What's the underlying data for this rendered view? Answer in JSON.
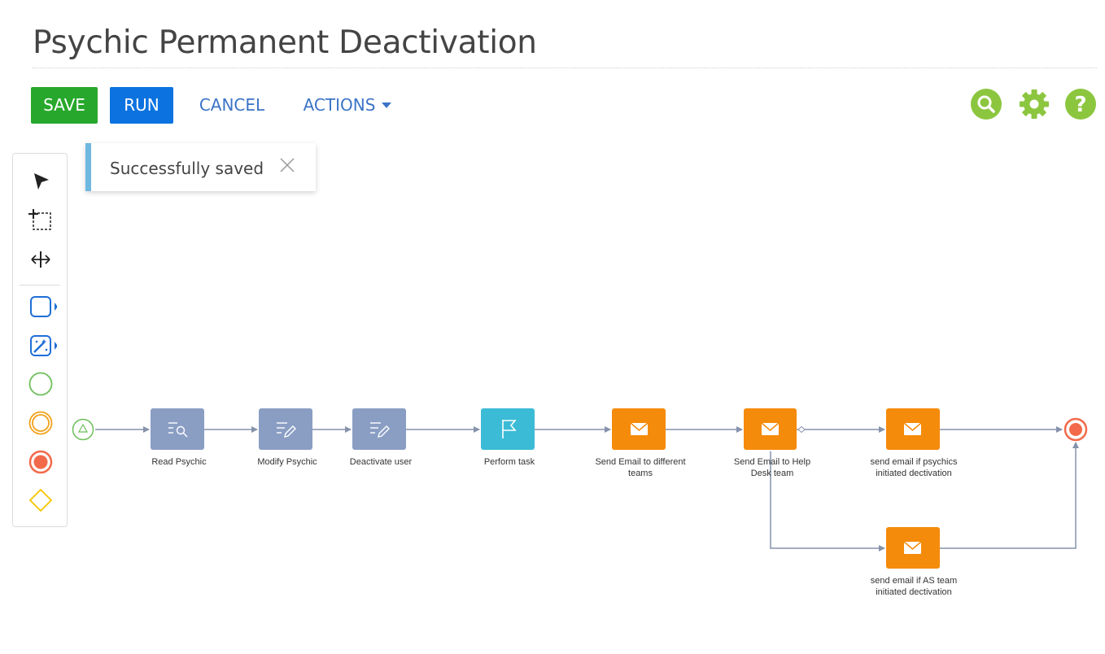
{
  "page": {
    "title": "Psychic Permanent Deactivation"
  },
  "toolbar": {
    "save_label": "SAVE",
    "run_label": "RUN",
    "cancel_label": "CANCEL",
    "actions_label": "ACTIONS",
    "right_icons": [
      "search-icon",
      "gear-icon",
      "help-icon"
    ],
    "accent_color": "#8cc63f"
  },
  "notification": {
    "message": "Successfully saved",
    "close_icon": "close-icon"
  },
  "palette": {
    "items": [
      "pointer-tool-icon",
      "lasso-select-tool-icon",
      "space-tool-icon",
      "task-element-icon",
      "script-task-element-icon",
      "start-event-icon",
      "intermediate-event-icon",
      "end-event-icon",
      "gateway-icon"
    ]
  },
  "process": {
    "nodes": [
      {
        "name": "start-event",
        "label": ""
      },
      {
        "name": "read-psychic-task",
        "label": "Read Psychic",
        "icon": "read-data-icon",
        "color": "#8a9ec4"
      },
      {
        "name": "modify-psychic-task",
        "label": "Modify Psychic",
        "icon": "modify-data-icon",
        "color": "#8a9ec4"
      },
      {
        "name": "deactivate-user-task",
        "label": "Deactivate user",
        "icon": "modify-data-icon",
        "color": "#8a9ec4"
      },
      {
        "name": "perform-task",
        "label": "Perform task",
        "icon": "flag-icon",
        "color": "#3cbbd6"
      },
      {
        "name": "send-email-teams-task",
        "label_line1": "Send Email to different",
        "label_line2": "teams",
        "icon": "email-icon",
        "color": "#f58b0a"
      },
      {
        "name": "send-email-helpdesk-task",
        "label_line1": "Send Email to Help",
        "label_line2": "Desk team",
        "icon": "email-icon",
        "color": "#f58b0a"
      },
      {
        "name": "send-email-psychics-task",
        "label_line1": "send email if psychics",
        "label_line2": "initiated dectivation",
        "icon": "email-icon",
        "color": "#f58b0a"
      },
      {
        "name": "send-email-as-team-task",
        "label_line1": "send email if AS team",
        "label_line2": "initiated dectivation",
        "icon": "email-icon",
        "color": "#f58b0a"
      },
      {
        "name": "end-event",
        "label": ""
      }
    ],
    "colors": {
      "flow_line": "#8592ab",
      "start": "#6cbf5a",
      "end": "#f26a4a"
    }
  }
}
